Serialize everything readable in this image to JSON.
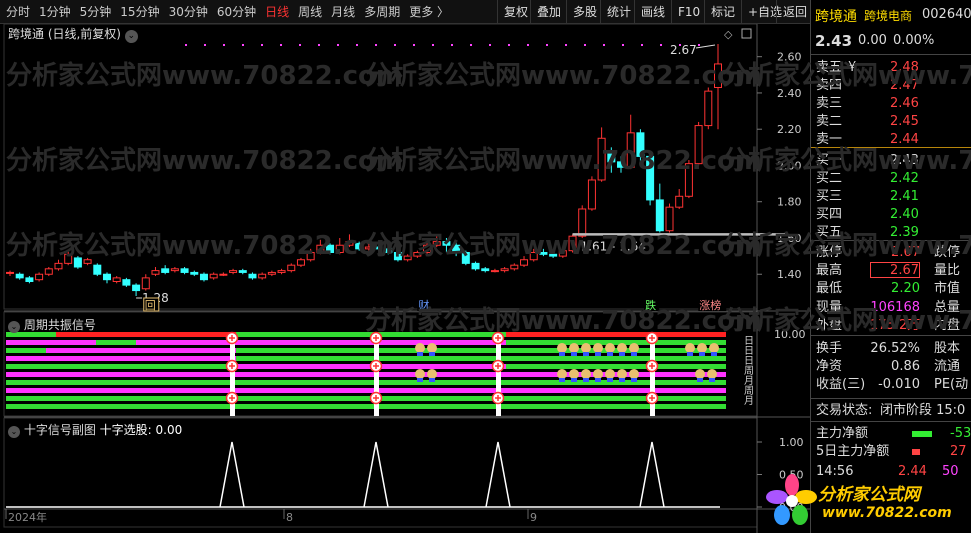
{
  "toolbar": {
    "periods": [
      "分时",
      "1分钟",
      "5分钟",
      "15分钟",
      "30分钟",
      "60分钟",
      "日线",
      "周线",
      "月线",
      "多周期",
      "更多 〉"
    ],
    "active": "日线",
    "right": [
      "复权",
      "叠加",
      "多股",
      "统计",
      "画线",
      "F10",
      "标记",
      "+自选",
      "返回"
    ]
  },
  "stock": {
    "name": "跨境通",
    "sector": "跨境电商",
    "code": "002640",
    "price": "2.43",
    "change": "0.00",
    "pct": "0.00%"
  },
  "chart_title": "跨境通 (日线,前复权)",
  "annotations": {
    "high": "2.67",
    "low": "1.28",
    "range": "1.61 - 1.64"
  },
  "markers": [
    {
      "label": "回",
      "color": "#e8c070"
    },
    {
      "label": "财",
      "color": "#6699ff"
    },
    {
      "label": "跌",
      "color": "#66ff66"
    },
    {
      "label": "涨榜",
      "color": "#ff8888"
    }
  ],
  "yaxis": {
    "ticks": [
      "2.60",
      "2.40",
      "2.20",
      "2.00",
      "1.80",
      "1.60",
      "1.40"
    ],
    "sub1_tick": "10.00",
    "sub2_ticks": [
      "1.00",
      "0.50",
      "0.00"
    ]
  },
  "sub1_title": "周期共振信号",
  "sub1_side_label": "日日日周月周月",
  "sub2_title": "十字信号副图",
  "sub2_value": "十字选股: 0.00",
  "xaxis": {
    "labels": [
      "2024年",
      "8",
      "9"
    ]
  },
  "watermark": "分析家公式网www.70822.com",
  "orderbook": [
    {
      "label": "卖五",
      "price": "2.48",
      "mark": "¥",
      "color": "#ff4444"
    },
    {
      "label": "卖四",
      "price": "2.47",
      "color": "#ff4444"
    },
    {
      "label": "卖三",
      "price": "2.46",
      "color": "#ff4444"
    },
    {
      "label": "卖二",
      "price": "2.45",
      "color": "#ff4444"
    },
    {
      "label": "卖一",
      "price": "2.44",
      "color": "#ff4444"
    },
    {
      "label": "买一",
      "price": "2.43",
      "color": "#dddddd"
    },
    {
      "label": "买二",
      "price": "2.42",
      "color": "#33ee33"
    },
    {
      "label": "买三",
      "price": "2.41",
      "color": "#33ee33"
    },
    {
      "label": "买四",
      "price": "2.40",
      "color": "#33ee33"
    },
    {
      "label": "买五",
      "price": "2.39",
      "color": "#33ee33"
    }
  ],
  "quote": [
    {
      "l": "涨停",
      "v": "2.67",
      "c": "#ff4444",
      "l2": "跌停"
    },
    {
      "l": "最高",
      "v": "2.67",
      "c": "#ff4444",
      "l2": "量比"
    },
    {
      "l": "最低",
      "v": "2.20",
      "c": "#33ee33",
      "l2": "市值"
    },
    {
      "l": "现量",
      "v": "106168",
      "c": "#ff44ff",
      "l2": "总量"
    },
    {
      "l": "外盘",
      "v": "175.2万",
      "c": "#ff4444",
      "l2": "内盘"
    },
    {
      "l": "换手",
      "v": "26.52%",
      "c": "#dddddd",
      "l2": "股本"
    },
    {
      "l": "净资",
      "v": "0.86",
      "c": "#dddddd",
      "l2": "流通"
    },
    {
      "l": "收益(三)",
      "v": "-0.010",
      "c": "#dddddd",
      "l2": "PE(动"
    }
  ],
  "status": {
    "label": "交易状态:",
    "value": "闭市阶段 15:0"
  },
  "flow": [
    {
      "l": "主力净额",
      "v": "-53",
      "c": "#33ee33"
    },
    {
      "l": "5日主力净额",
      "v": "27",
      "c": "#ff4444"
    }
  ],
  "tick": {
    "time": "14:56",
    "price": "2.44",
    "vol": "50"
  },
  "logo": {
    "cn": "分析家公式网",
    "url": "www.70822.com"
  },
  "chart_data": [
    {
      "type": "candlestick",
      "title": "跨境通 (日线,前复权)",
      "ylim": [
        1.28,
        2.67
      ],
      "ylabels": [
        "2.60",
        "2.40",
        "2.20",
        "2.00",
        "1.80",
        "1.60",
        "1.40"
      ],
      "x_labels": [
        "2024年",
        "8",
        "9"
      ],
      "candles": [
        [
          1.41,
          1.41,
          1.42,
          1.39
        ],
        [
          1.4,
          1.38,
          1.41,
          1.37
        ],
        [
          1.38,
          1.36,
          1.39,
          1.35
        ],
        [
          1.37,
          1.4,
          1.41,
          1.36
        ],
        [
          1.4,
          1.43,
          1.44,
          1.39
        ],
        [
          1.43,
          1.46,
          1.48,
          1.42
        ],
        [
          1.46,
          1.51,
          1.53,
          1.45
        ],
        [
          1.49,
          1.44,
          1.5,
          1.43
        ],
        [
          1.46,
          1.48,
          1.49,
          1.45
        ],
        [
          1.45,
          1.4,
          1.46,
          1.39
        ],
        [
          1.4,
          1.37,
          1.41,
          1.35
        ],
        [
          1.36,
          1.38,
          1.39,
          1.35
        ],
        [
          1.37,
          1.34,
          1.38,
          1.33
        ],
        [
          1.34,
          1.31,
          1.35,
          1.28
        ],
        [
          1.32,
          1.38,
          1.4,
          1.31
        ],
        [
          1.4,
          1.42,
          1.44,
          1.39
        ],
        [
          1.43,
          1.41,
          1.45,
          1.4
        ],
        [
          1.42,
          1.43,
          1.44,
          1.41
        ],
        [
          1.43,
          1.41,
          1.44,
          1.4
        ],
        [
          1.41,
          1.4,
          1.42,
          1.39
        ],
        [
          1.4,
          1.37,
          1.41,
          1.36
        ],
        [
          1.38,
          1.4,
          1.41,
          1.37
        ],
        [
          1.4,
          1.4,
          1.41,
          1.39
        ],
        [
          1.41,
          1.42,
          1.43,
          1.4
        ],
        [
          1.42,
          1.41,
          1.43,
          1.4
        ],
        [
          1.4,
          1.38,
          1.41,
          1.37
        ],
        [
          1.38,
          1.4,
          1.41,
          1.37
        ],
        [
          1.4,
          1.41,
          1.42,
          1.39
        ],
        [
          1.41,
          1.42,
          1.43,
          1.4
        ],
        [
          1.42,
          1.45,
          1.46,
          1.41
        ],
        [
          1.45,
          1.48,
          1.49,
          1.44
        ],
        [
          1.48,
          1.52,
          1.54,
          1.47
        ],
        [
          1.52,
          1.56,
          1.59,
          1.51
        ],
        [
          1.56,
          1.52,
          1.57,
          1.51
        ],
        [
          1.52,
          1.56,
          1.6,
          1.51
        ],
        [
          1.56,
          1.58,
          1.62,
          1.55
        ],
        [
          1.57,
          1.54,
          1.58,
          1.53
        ],
        [
          1.54,
          1.55,
          1.57,
          1.53
        ],
        [
          1.55,
          1.54,
          1.56,
          1.53
        ],
        [
          1.54,
          1.52,
          1.55,
          1.51
        ],
        [
          1.52,
          1.48,
          1.53,
          1.47
        ],
        [
          1.48,
          1.5,
          1.51,
          1.47
        ],
        [
          1.5,
          1.52,
          1.53,
          1.49
        ],
        [
          1.52,
          1.56,
          1.58,
          1.5
        ],
        [
          1.56,
          1.58,
          1.62,
          1.55
        ],
        [
          1.58,
          1.56,
          1.6,
          1.52
        ],
        [
          1.56,
          1.52,
          1.58,
          1.5
        ],
        [
          1.52,
          1.46,
          1.53,
          1.45
        ],
        [
          1.46,
          1.43,
          1.47,
          1.42
        ],
        [
          1.43,
          1.42,
          1.44,
          1.41
        ],
        [
          1.42,
          1.42,
          1.43,
          1.41
        ],
        [
          1.42,
          1.43,
          1.44,
          1.41
        ],
        [
          1.43,
          1.45,
          1.46,
          1.42
        ],
        [
          1.45,
          1.48,
          1.5,
          1.44
        ],
        [
          1.48,
          1.52,
          1.54,
          1.47
        ],
        [
          1.52,
          1.51,
          1.54,
          1.5
        ],
        [
          1.51,
          1.5,
          1.52,
          1.49
        ],
        [
          1.5,
          1.53,
          1.55,
          1.49
        ],
        [
          1.53,
          1.61,
          1.62,
          1.52
        ],
        [
          1.61,
          1.76,
          1.78,
          1.6
        ],
        [
          1.76,
          1.92,
          1.94,
          1.75
        ],
        [
          1.92,
          2.15,
          2.21,
          1.91
        ],
        [
          2.08,
          2.02,
          2.1,
          1.96
        ],
        [
          2.02,
          1.99,
          2.05,
          1.96
        ],
        [
          1.99,
          2.18,
          2.28,
          1.98
        ],
        [
          2.18,
          2.05,
          2.2,
          2.0
        ],
        [
          2.05,
          1.81,
          2.06,
          1.78
        ],
        [
          1.81,
          1.64,
          1.9,
          1.63
        ],
        [
          1.64,
          1.77,
          1.79,
          1.63
        ],
        [
          1.77,
          1.83,
          1.87,
          1.76
        ],
        [
          1.83,
          2.01,
          2.03,
          1.82
        ],
        [
          2.01,
          2.22,
          2.24,
          2.0
        ],
        [
          2.22,
          2.41,
          2.43,
          2.2
        ],
        [
          2.43,
          2.56,
          2.67,
          2.2
        ]
      ]
    },
    {
      "type": "bar",
      "title": "周期共振信号",
      "rows": [
        "日",
        "日",
        "日",
        "周",
        "月",
        "周",
        "月"
      ]
    },
    {
      "type": "line",
      "title": "十字信号副图",
      "ylim": [
        0,
        1
      ],
      "ylabels": [
        "1.00",
        "0.50",
        "0.00"
      ],
      "spikes_at": [
        31,
        50,
        67,
        88
      ],
      "series": [
        {
          "name": "十字选股",
          "last": "0.00"
        }
      ]
    }
  ]
}
